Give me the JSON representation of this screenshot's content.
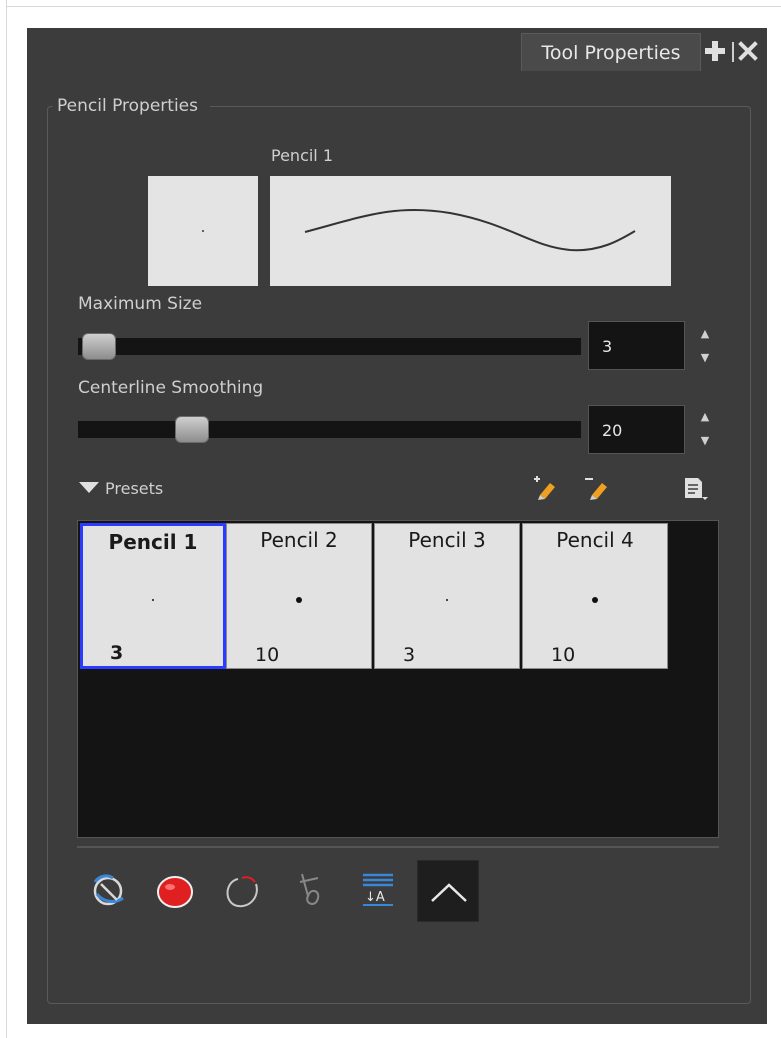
{
  "window": {
    "tab_label": "Tool Properties"
  },
  "group": {
    "title": "Pencil Properties"
  },
  "preview": {
    "brush_name": "Pencil 1"
  },
  "max_size": {
    "label": "Maximum Size",
    "value": "3",
    "slider_fraction": 0.0
  },
  "centerline_smoothing": {
    "label": "Centerline Smoothing",
    "value": "20",
    "slider_fraction": 0.2
  },
  "presets": {
    "label": "Presets",
    "items": [
      {
        "name": "Pencil 1",
        "size": "3",
        "selected": true
      },
      {
        "name": "Pencil 2",
        "size": "10",
        "selected": false
      },
      {
        "name": "Pencil 3",
        "size": "3",
        "selected": false
      },
      {
        "name": "Pencil 4",
        "size": "10",
        "selected": false
      }
    ]
  },
  "toolbar": {
    "buttons": [
      {
        "icon": "auto-flatten-icon"
      },
      {
        "icon": "auto-create-color-art-icon"
      },
      {
        "icon": "auto-close-gap-icon"
      },
      {
        "icon": "stroke-tip-icon"
      },
      {
        "icon": "text-stroke-order-icon"
      },
      {
        "icon": "pencil-tip-shape-icon",
        "active": true
      }
    ]
  },
  "colors": {
    "panel_bg": "#3c3c3c",
    "field_bg": "#141414",
    "selection_border": "#2b3bff",
    "accent_red": "#e02020",
    "accent_blue": "#3a86d8"
  }
}
